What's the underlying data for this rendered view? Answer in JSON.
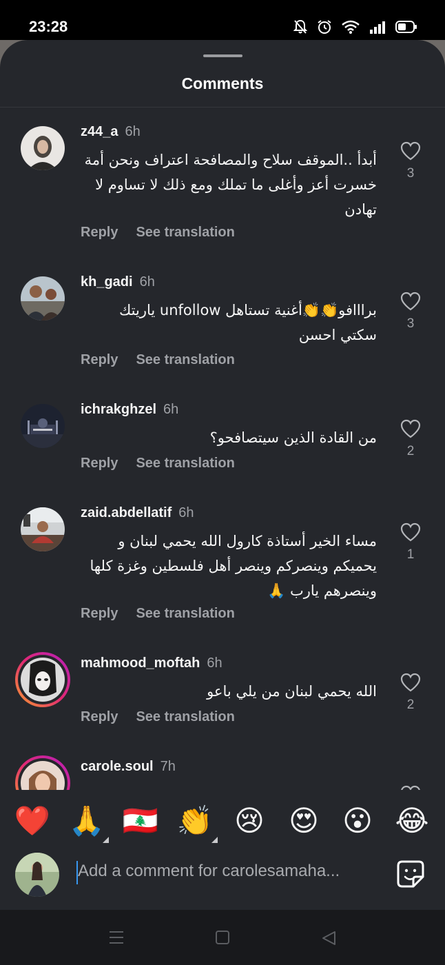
{
  "status_bar": {
    "time": "23:28",
    "icons": [
      "mute-icon",
      "alarm-icon",
      "wifi-icon",
      "signal-icon",
      "battery-icon"
    ]
  },
  "sheet": {
    "title": "Comments"
  },
  "comments": [
    {
      "username": "z44_a",
      "time": "6h",
      "text": "أبدأ ..الموقف سلاح والمصافحة اعتراف ونحن أمة خسرت أعز وأغلى ما تملك ومع ذلك لا تساوم لا تهادن",
      "likes": "3",
      "reply_label": "Reply",
      "translate_label": "See translation"
    },
    {
      "username": "kh_gadi",
      "time": "6h",
      "text": "برااافو👏👏أغنية تستاهل unfollow ياريتك سكتي احسن",
      "likes": "3",
      "reply_label": "Reply",
      "translate_label": "See translation"
    },
    {
      "username": "ichrakghzel",
      "time": "6h",
      "text": "من القادة الذين سيتصافحو؟",
      "likes": "2",
      "reply_label": "Reply",
      "translate_label": "See translation"
    },
    {
      "username": "zaid.abdellatif",
      "time": "6h",
      "text": "مساء الخير أستاذة كارول الله يحمي لبنان و يحميكم وينصركم وينصر أهل فلسطين وغزة كلها وينصرهم يارب 🙏",
      "likes": "1",
      "reply_label": "Reply",
      "translate_label": "See translation"
    },
    {
      "username": "mahmood_moftah",
      "time": "6h",
      "text": "الله يحمي لبنان من يلي باعو",
      "likes": "2",
      "reply_label": "Reply",
      "translate_label": "See translation"
    },
    {
      "username": "carole.soul",
      "time": "7h",
      "text": "",
      "likes": "",
      "reply_label": "",
      "translate_label": ""
    }
  ],
  "emoji_bar": [
    "❤️",
    "🙏",
    "🇱🇧",
    "👏",
    "😢",
    "😍",
    "😮",
    "😂"
  ],
  "input": {
    "placeholder": "Add a comment for carolesamaha..."
  },
  "colors": {
    "sheet_bg": "#25272c",
    "text_primary": "#f5f5f5",
    "text_secondary": "#9fa1a6",
    "cursor": "#3897f0"
  }
}
